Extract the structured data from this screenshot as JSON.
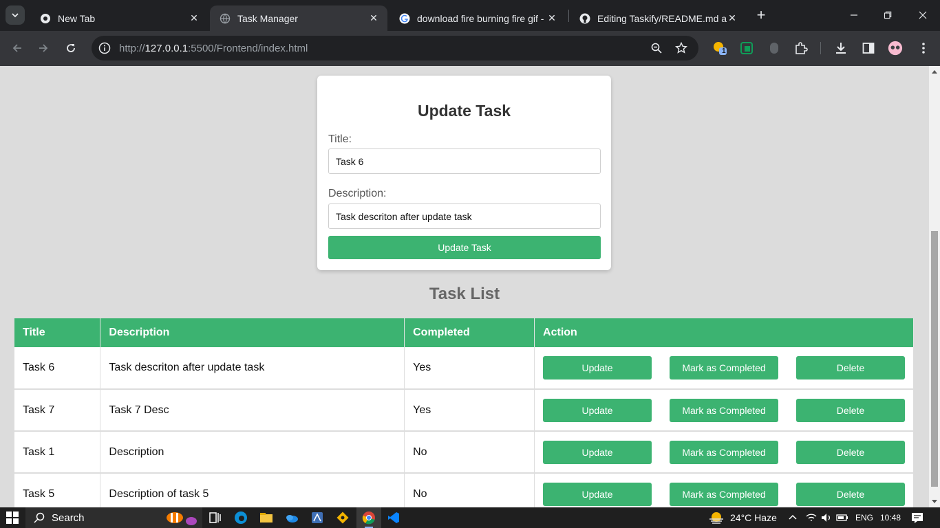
{
  "browser": {
    "tabs": [
      {
        "label": "New Tab"
      },
      {
        "label": "Task Manager"
      },
      {
        "label": "download fire burning fire gif -"
      },
      {
        "label": "Editing Taskify/README.md at m"
      }
    ],
    "url_prefix": "http://",
    "url_host": "127.0.0.1",
    "url_rest": ":5500/Frontend/index.html",
    "ext_badge": "1"
  },
  "form": {
    "heading": "Update Task",
    "title_label": "Title:",
    "title_value": "Task 6",
    "desc_label": "Description:",
    "desc_value": "Task descriton after update task",
    "submit_label": "Update Task"
  },
  "list": {
    "heading": "Task List",
    "columns": [
      "Title",
      "Description",
      "Completed",
      "Action"
    ],
    "rows": [
      {
        "title": "Task 6",
        "description": "Task descriton after update task",
        "completed": "Yes"
      },
      {
        "title": "Task 7",
        "description": "Task 7 Desc",
        "completed": "Yes"
      },
      {
        "title": "Task 1",
        "description": "Description",
        "completed": "No"
      },
      {
        "title": "Task 5",
        "description": "Description of task 5",
        "completed": "No"
      }
    ],
    "actions": {
      "update": "Update",
      "complete": "Mark as Completed",
      "delete": "Delete"
    }
  },
  "taskbar": {
    "search": "Search",
    "weather": "24°C  Haze",
    "lang": "ENG",
    "time": "10:48"
  },
  "colors": {
    "accent": "#3cb371",
    "page_bg": "#dcdcdc"
  }
}
